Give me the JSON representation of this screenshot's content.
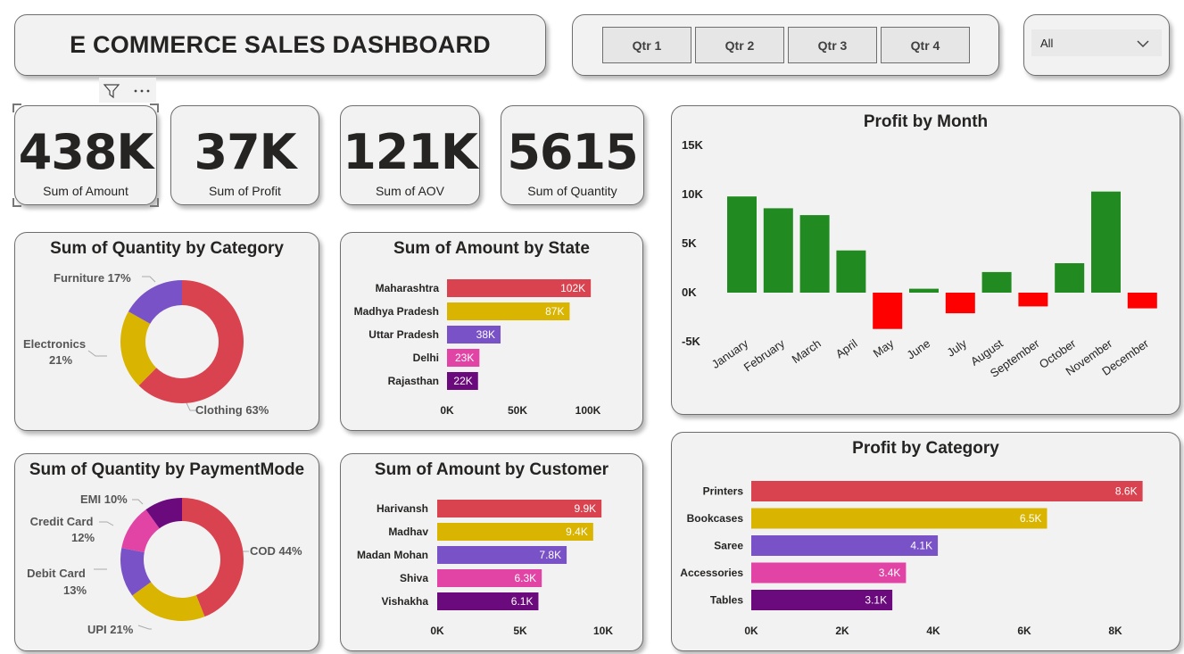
{
  "header": {
    "title": "E COMMERCE SALES DASHBOARD"
  },
  "quarters": [
    "Qtr 1",
    "Qtr 2",
    "Qtr 3",
    "Qtr 4"
  ],
  "dropdown": {
    "selected": "All"
  },
  "visual_header": {
    "filter_icon": "filter-icon",
    "more_icon": "more-options-icon"
  },
  "kpis": [
    {
      "value": "438K",
      "label": "Sum of Amount"
    },
    {
      "value": "37K",
      "label": "Sum of Profit"
    },
    {
      "value": "121K",
      "label": "Sum of AOV"
    },
    {
      "value": "5615",
      "label": "Sum of Quantity"
    }
  ],
  "colors": {
    "red": "#d9434f",
    "yellow": "#d9b400",
    "purple": "#7952c7",
    "pink": "#e144a4",
    "darkpurple": "#6b0a7d",
    "green": "#218a21",
    "negative": "#ff0000"
  },
  "chart_data": [
    {
      "id": "quantity_by_category",
      "type": "pie",
      "title": "Sum of Quantity by Category",
      "categories": [
        "Clothing",
        "Electronics",
        "Furniture"
      ],
      "values": [
        63,
        21,
        17
      ],
      "labels": [
        "Clothing 63%",
        "Electronics",
        "21%",
        "Furniture 17%"
      ]
    },
    {
      "id": "amount_by_state",
      "type": "bar",
      "title": "Sum of Amount by State",
      "categories": [
        "Maharashtra",
        "Madhya Pradesh",
        "Uttar Pradesh",
        "Delhi",
        "Rajasthan"
      ],
      "values": [
        102,
        87,
        38,
        23,
        22
      ],
      "data_labels": [
        "102K",
        "87K",
        "38K",
        "23K",
        "22K"
      ],
      "xlim": [
        0,
        100
      ],
      "ticks": [
        "0K",
        "50K",
        "100K"
      ]
    },
    {
      "id": "profit_by_month",
      "type": "bar",
      "title": "Profit by Month",
      "categories": [
        "January",
        "February",
        "March",
        "April",
        "May",
        "June",
        "July",
        "August",
        "September",
        "October",
        "November",
        "December"
      ],
      "values": [
        9.8,
        8.6,
        7.9,
        4.3,
        -3.7,
        0.4,
        -2.1,
        2.1,
        -1.4,
        3.0,
        10.3,
        -1.6
      ],
      "ylim": [
        -5,
        15
      ],
      "ticks": [
        "15K",
        "10K",
        "5K",
        "0K",
        "-5K"
      ]
    },
    {
      "id": "quantity_by_paymentmode",
      "type": "pie",
      "title": "Sum of Quantity by PaymentMode",
      "categories": [
        "COD",
        "UPI",
        "Debit Card",
        "Credit Card",
        "EMI"
      ],
      "values": [
        44,
        21,
        13,
        12,
        10
      ],
      "labels": [
        "COD 44%",
        "UPI 21%",
        "Debit Card",
        "13%",
        "Credit Card",
        "12%",
        "EMI 10%"
      ]
    },
    {
      "id": "amount_by_customer",
      "type": "bar",
      "title": "Sum of Amount by Customer",
      "categories": [
        "Harivansh",
        "Madhav",
        "Madan Mohan",
        "Shiva",
        "Vishakha"
      ],
      "values": [
        9.9,
        9.4,
        7.8,
        6.3,
        6.1
      ],
      "data_labels": [
        "9.9K",
        "9.4K",
        "7.8K",
        "6.3K",
        "6.1K"
      ],
      "xlim": [
        0,
        10
      ],
      "ticks": [
        "0K",
        "5K",
        "10K"
      ]
    },
    {
      "id": "profit_by_category",
      "type": "bar",
      "title": "Profit by Category",
      "categories": [
        "Printers",
        "Bookcases",
        "Saree",
        "Accessories",
        "Tables"
      ],
      "values": [
        8.6,
        6.5,
        4.1,
        3.4,
        3.1
      ],
      "data_labels": [
        "8.6K",
        "6.5K",
        "4.1K",
        "3.4K",
        "3.1K"
      ],
      "xlim": [
        0,
        8
      ],
      "ticks": [
        "0K",
        "2K",
        "4K",
        "6K",
        "8K"
      ]
    }
  ]
}
